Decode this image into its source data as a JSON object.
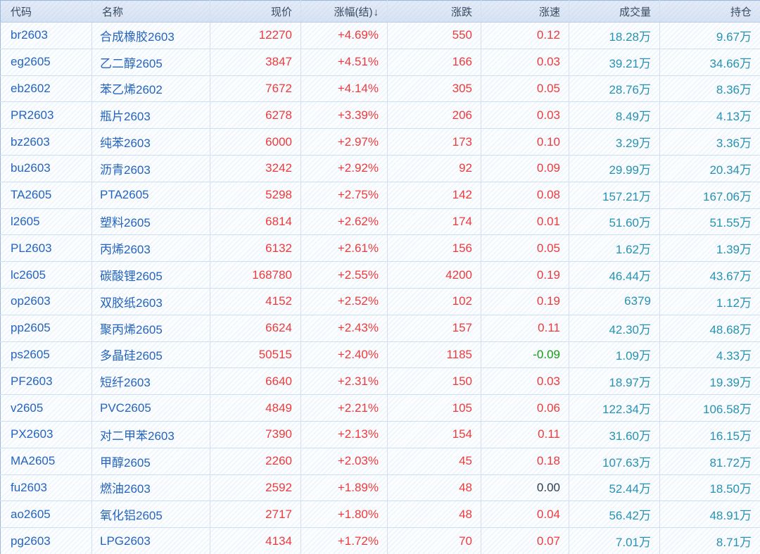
{
  "table": {
    "columns": [
      "代码",
      "名称",
      "现价",
      "涨幅(结)",
      "涨跌",
      "涨速",
      "成交量",
      "持仓"
    ],
    "sort_indicator": "↓",
    "rows": [
      {
        "code": "br2603",
        "name": "合成橡胶2603",
        "price": "12270",
        "change_pct": "+4.69%",
        "change": "550",
        "speed": "0.12",
        "volume": "18.28万",
        "open_interest": "9.67万"
      },
      {
        "code": "eg2605",
        "name": "乙二醇2605",
        "price": "3847",
        "change_pct": "+4.51%",
        "change": "166",
        "speed": "0.03",
        "volume": "39.21万",
        "open_interest": "34.66万"
      },
      {
        "code": "eb2602",
        "name": "苯乙烯2602",
        "price": "7672",
        "change_pct": "+4.14%",
        "change": "305",
        "speed": "0.05",
        "volume": "28.76万",
        "open_interest": "8.36万"
      },
      {
        "code": "PR2603",
        "name": "瓶片2603",
        "price": "6278",
        "change_pct": "+3.39%",
        "change": "206",
        "speed": "0.03",
        "volume": "8.49万",
        "open_interest": "4.13万"
      },
      {
        "code": "bz2603",
        "name": "纯苯2603",
        "price": "6000",
        "change_pct": "+2.97%",
        "change": "173",
        "speed": "0.10",
        "volume": "3.29万",
        "open_interest": "3.36万"
      },
      {
        "code": "bu2603",
        "name": "沥青2603",
        "price": "3242",
        "change_pct": "+2.92%",
        "change": "92",
        "speed": "0.09",
        "volume": "29.99万",
        "open_interest": "20.34万"
      },
      {
        "code": "TA2605",
        "name": "PTA2605",
        "price": "5298",
        "change_pct": "+2.75%",
        "change": "142",
        "speed": "0.08",
        "volume": "157.21万",
        "open_interest": "167.06万"
      },
      {
        "code": "l2605",
        "name": "塑料2605",
        "price": "6814",
        "change_pct": "+2.62%",
        "change": "174",
        "speed": "0.01",
        "volume": "51.60万",
        "open_interest": "51.55万"
      },
      {
        "code": "PL2603",
        "name": "丙烯2603",
        "price": "6132",
        "change_pct": "+2.61%",
        "change": "156",
        "speed": "0.05",
        "volume": "1.62万",
        "open_interest": "1.39万"
      },
      {
        "code": "lc2605",
        "name": "碳酸锂2605",
        "price": "168780",
        "change_pct": "+2.55%",
        "change": "4200",
        "speed": "0.19",
        "volume": "46.44万",
        "open_interest": "43.67万"
      },
      {
        "code": "op2603",
        "name": "双胶纸2603",
        "price": "4152",
        "change_pct": "+2.52%",
        "change": "102",
        "speed": "0.19",
        "volume": "6379",
        "open_interest": "1.12万"
      },
      {
        "code": "pp2605",
        "name": "聚丙烯2605",
        "price": "6624",
        "change_pct": "+2.43%",
        "change": "157",
        "speed": "0.11",
        "volume": "42.30万",
        "open_interest": "48.68万"
      },
      {
        "code": "ps2605",
        "name": "多晶硅2605",
        "price": "50515",
        "change_pct": "+2.40%",
        "change": "1185",
        "speed": "-0.09",
        "volume": "1.09万",
        "open_interest": "4.33万"
      },
      {
        "code": "PF2603",
        "name": "短纤2603",
        "price": "6640",
        "change_pct": "+2.31%",
        "change": "150",
        "speed": "0.03",
        "volume": "18.97万",
        "open_interest": "19.39万"
      },
      {
        "code": "v2605",
        "name": "PVC2605",
        "price": "4849",
        "change_pct": "+2.21%",
        "change": "105",
        "speed": "0.06",
        "volume": "122.34万",
        "open_interest": "106.58万"
      },
      {
        "code": "PX2603",
        "name": "对二甲苯2603",
        "price": "7390",
        "change_pct": "+2.13%",
        "change": "154",
        "speed": "0.11",
        "volume": "31.60万",
        "open_interest": "16.15万"
      },
      {
        "code": "MA2605",
        "name": "甲醇2605",
        "price": "2260",
        "change_pct": "+2.03%",
        "change": "45",
        "speed": "0.18",
        "volume": "107.63万",
        "open_interest": "81.72万"
      },
      {
        "code": "fu2603",
        "name": "燃油2603",
        "price": "2592",
        "change_pct": "+1.89%",
        "change": "48",
        "speed": "0.00",
        "volume": "52.44万",
        "open_interest": "18.50万"
      },
      {
        "code": "ao2605",
        "name": "氧化铝2605",
        "price": "2717",
        "change_pct": "+1.80%",
        "change": "48",
        "speed": "0.04",
        "volume": "56.42万",
        "open_interest": "48.91万"
      },
      {
        "code": "pg2603",
        "name": "LPG2603",
        "price": "4134",
        "change_pct": "+1.72%",
        "change": "70",
        "speed": "0.07",
        "volume": "7.01万",
        "open_interest": "8.71万"
      }
    ]
  },
  "colors": {
    "up_red": "#ee3a3b",
    "down_green": "#149c14",
    "flat_dark": "#2b3b52",
    "code_blue": "#2464be",
    "volume_teal": "#2792b2",
    "header_bg": "#dce7f5",
    "grid_line": "#cfdff2"
  }
}
